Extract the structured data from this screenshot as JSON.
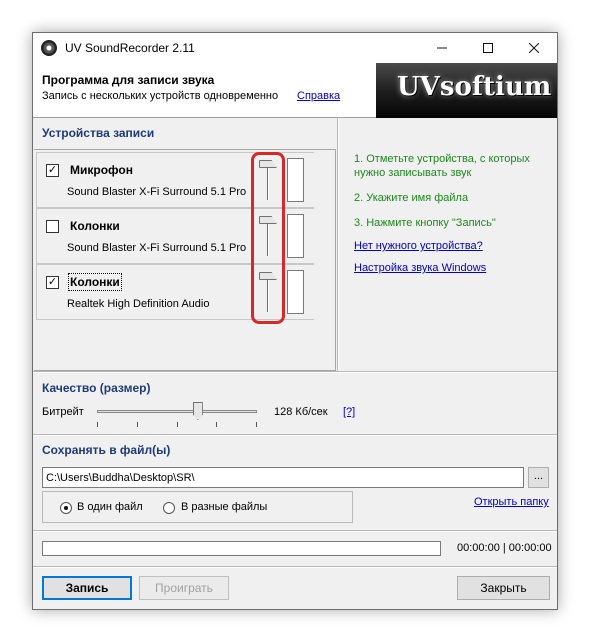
{
  "window": {
    "title": "UV SoundRecorder 2.11"
  },
  "header": {
    "title": "Программа для записи звука",
    "subtitle": "Запись с нескольких устройств одновременно",
    "help_link": "Справка",
    "logo_text": "UVsoftium"
  },
  "devices": {
    "section_title": "Устройства записи",
    "items": [
      {
        "name": "Микрофон",
        "description": "Sound Blaster X-Fi Surround 5.1 Pro",
        "checked": true,
        "check_mark": "✓",
        "volume_level": 1.0
      },
      {
        "name": "Колонки",
        "description": "Sound Blaster X-Fi Surround 5.1 Pro",
        "checked": false,
        "check_mark": "",
        "volume_level": 1.0
      },
      {
        "name": "Колонки",
        "description": "Realtek High Definition Audio",
        "checked": true,
        "check_mark": "✓",
        "volume_level": 1.0
      }
    ]
  },
  "instructions": {
    "step1_line1": "1. Отметьте устройства, с которых",
    "step1_line2": "нужно записывать звук",
    "step2": "2. Укажите имя файла",
    "step3": "3. Нажмите кнопку \"Запись\"",
    "link_no_device": "Нет нужного устройства?",
    "link_windows_sound": "Настройка звука Windows",
    "color": "#1c8a1c"
  },
  "quality": {
    "section_title": "Качество (размер)",
    "bitrate_label": "Битрейт",
    "bitrate_value": "128 Кб/сек",
    "bitrate_position": 0.63,
    "help": "[?]"
  },
  "save": {
    "section_title": "Сохранять в файл(ы)",
    "path": "C:\\Users\\Buddha\\Desktop\\SR\\",
    "browse_label": "...",
    "option_single": "В один файл",
    "option_multiple": "В разные файлы",
    "selected_option": "single",
    "open_folder": "Открыть папку"
  },
  "status": {
    "progress": 0,
    "time": "00:00:00 | 00:00:00"
  },
  "buttons": {
    "record": "Запись",
    "play": "Проиграть",
    "close": "Закрыть"
  }
}
